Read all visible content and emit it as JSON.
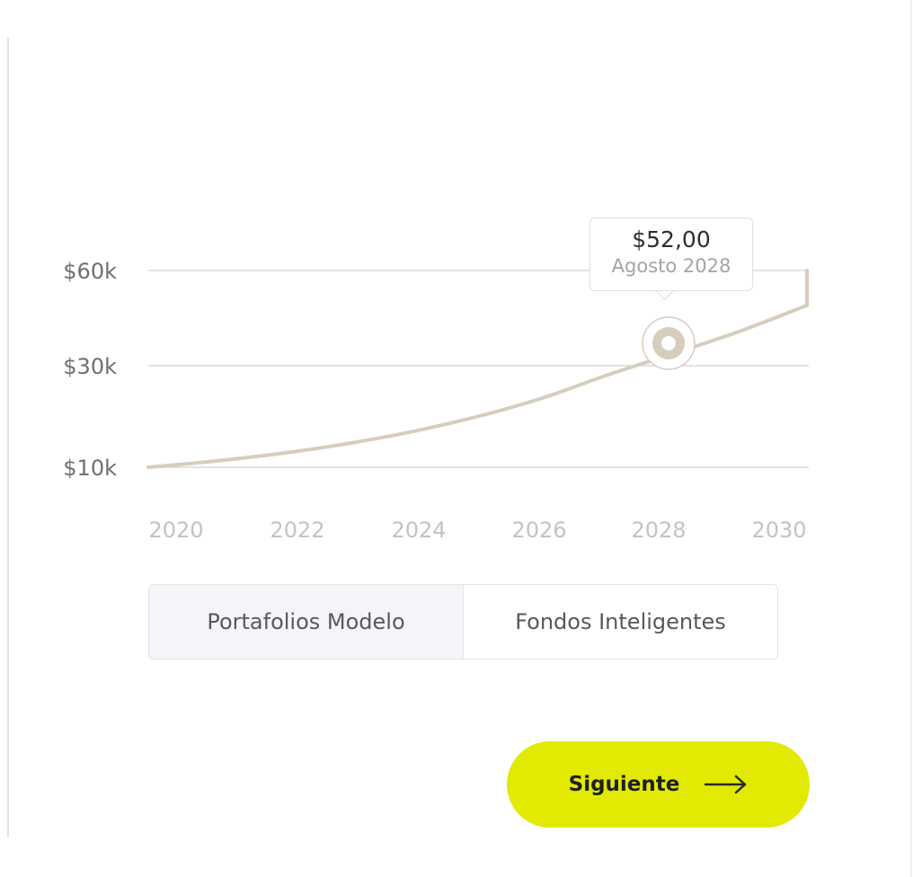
{
  "chart_data": {
    "type": "line",
    "x_ticks": [
      "2020",
      "2022",
      "2024",
      "2026",
      "2028",
      "2030"
    ],
    "y_ticks": [
      "$10k",
      "$30k",
      "$60k"
    ],
    "series": [
      {
        "x": [
          2020,
          2021,
          2022,
          2023,
          2024,
          2025,
          2026,
          2027,
          2028,
          2029,
          2030
        ],
        "y": [
          10000,
          11200,
          12700,
          14600,
          17000,
          20000,
          23700,
          28300,
          34000,
          41000,
          49000
        ]
      }
    ],
    "ylim": [
      10000,
      60000
    ],
    "xlim": [
      2020,
      2030
    ],
    "highlight": {
      "x": 2028.5,
      "y": 37000,
      "label_value": "$52,00",
      "label_date": "Agosto 2028"
    },
    "line_color": "#d6cdbd",
    "grid_color": "#d8d8d8"
  },
  "toggle": {
    "options": [
      "Portafolios Modelo",
      "Fondos Inteligentes"
    ],
    "selected": "Portafolios Modelo"
  },
  "next_button": {
    "label": "Siguiente",
    "icon": "arrow-right-icon",
    "color": "#e2ea03"
  }
}
